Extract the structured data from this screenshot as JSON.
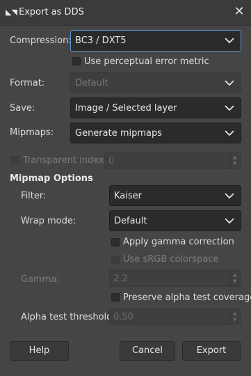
{
  "window": {
    "title": "Export as DDS"
  },
  "compression": {
    "label": "Compression:",
    "value": "BC3 / DXT5"
  },
  "perceptual": {
    "label": "Use perceptual error metric"
  },
  "format": {
    "label": "Format:",
    "value": "Default"
  },
  "save": {
    "label": "Save:",
    "value": "Image / Selected layer"
  },
  "mipmaps": {
    "label": "Mipmaps:",
    "value": "Generate mipmaps"
  },
  "transparent_index": {
    "label": "Transparent index:",
    "value": "0"
  },
  "mipmap_options": {
    "heading": "Mipmap Options",
    "filter": {
      "label": "Filter:",
      "value": "Kaiser"
    },
    "wrap_mode": {
      "label": "Wrap mode:",
      "value": "Default"
    },
    "apply_gamma": {
      "label": "Apply gamma correction"
    },
    "use_srgb": {
      "label": "Use sRGB colorspace"
    },
    "gamma": {
      "label": "Gamma:",
      "value": "2.2"
    },
    "preserve_alpha": {
      "label": "Preserve alpha test coverage"
    },
    "alpha_threshold": {
      "label": "Alpha test threshold:",
      "value": "0.50"
    }
  },
  "buttons": {
    "help": "Help",
    "cancel": "Cancel",
    "export": "Export"
  },
  "colors": {
    "focus_border": "#5e97d6",
    "background": "#454545"
  }
}
